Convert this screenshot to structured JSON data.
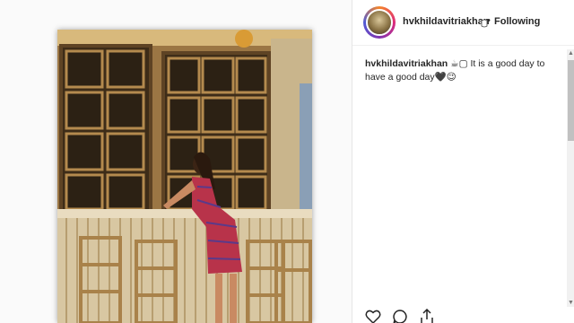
{
  "post": {
    "username": "hvkhildavitriakhan",
    "separator": "•",
    "follow_status": "Following",
    "caption_user": "hvkhildavitriakhan",
    "caption_text": "☕▢ It is a good day to have a good day🖤😉"
  },
  "icons": {
    "verified": "verified-icon",
    "like": "heart-icon",
    "comment": "comment-icon",
    "share": "share-icon"
  },
  "colors": {
    "text": "#262626",
    "background": "#fafafa",
    "panel": "#ffffff"
  }
}
